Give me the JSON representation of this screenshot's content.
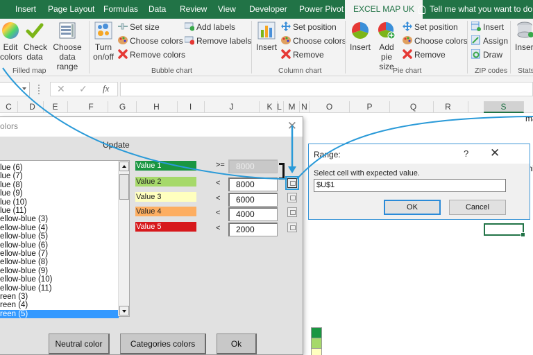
{
  "ribbon": {
    "tabs": [
      {
        "label": "Insert",
        "active": false
      },
      {
        "label": "Page Layout",
        "active": false
      },
      {
        "label": "Formulas",
        "active": false
      },
      {
        "label": "Data",
        "active": false
      },
      {
        "label": "Review",
        "active": false
      },
      {
        "label": "View",
        "active": false
      },
      {
        "label": "Developer",
        "active": false
      },
      {
        "label": "Power Pivot",
        "active": false
      },
      {
        "label": "EXCEL MAP UK",
        "active": true
      }
    ],
    "tell_me": "Tell me what you want to do",
    "groups": {
      "filled_map": {
        "label": "Filled map",
        "edit_colors": [
          "Edit",
          "colors"
        ],
        "check_data": [
          "Check",
          "data"
        ],
        "choose_data_range": [
          "Choose",
          "data range"
        ]
      },
      "bubble_chart": {
        "label": "Bubble chart",
        "turn_onoff": [
          "Turn",
          "on/off"
        ],
        "set_size": "Set size",
        "choose_colors": "Choose colors",
        "remove_colors": "Remove colors",
        "add_labels": "Add labels",
        "remove_labels": "Remove labels"
      },
      "column_chart": {
        "label": "Column chart",
        "insert": "Insert",
        "set_position": "Set position",
        "choose_colors": "Choose colors",
        "remove": "Remove"
      },
      "pie_chart": {
        "label": "Pie chart",
        "insert": "Insert",
        "add_pie_size": [
          "Add",
          "pie size"
        ],
        "set_position": "Set position",
        "choose_colors": "Choose colors",
        "remove": "Remove"
      },
      "zip_codes": {
        "label": "ZIP codes",
        "insert": "Insert",
        "assign": "Assign",
        "draw": "Draw"
      },
      "stats": {
        "label": "Stats",
        "insert": "Insert"
      }
    }
  },
  "formula_bar": {
    "cancel_glyph": "✕",
    "enter_glyph": "✓",
    "fx_label": "fx",
    "value": ""
  },
  "columns": [
    "C",
    "D",
    "E",
    "F",
    "G",
    "H",
    "I",
    "J",
    "K",
    "L",
    "M",
    "N",
    "O",
    "P",
    "Q",
    "R",
    "S"
  ],
  "selected_column": "S",
  "sheet_text": {
    "cell_ma": "ma",
    "cell_mi": "mi"
  },
  "legend_colors": [
    "#1a9641",
    "#a6d96a",
    "#ffffbf"
  ],
  "colors_dialog": {
    "title": "olors",
    "close_glyph": "✕",
    "update_label": "Update",
    "list_items": [
      "lue (6)",
      "lue (7)",
      "lue (8)",
      "lue (9)",
      "lue (10)",
      "lue (11)",
      "ellow-blue (3)",
      "ellow-blue (4)",
      "ellow-blue (5)",
      "ellow-blue (6)",
      "ellow-blue (7)",
      "ellow-blue (8)",
      "ellow-blue (9)",
      "ellow-blue (10)",
      "ellow-blue (11)",
      "reen (3)",
      "reen (4)",
      "reen (5)"
    ],
    "selected_index": 17,
    "values": [
      {
        "label": "Value 1",
        "color": "#1a9641",
        "text_color": "#ffffff",
        "op": ">=",
        "value": "8000",
        "disabled": true
      },
      {
        "label": "Value 2",
        "color": "#a6d96a",
        "text_color": "#222222",
        "op": "<",
        "value": "8000",
        "disabled": false
      },
      {
        "label": "Value 3",
        "color": "#ffffbf",
        "text_color": "#222222",
        "op": "<",
        "value": "6000",
        "disabled": false
      },
      {
        "label": "Value 4",
        "color": "#fdae61",
        "text_color": "#222222",
        "op": "<",
        "value": "4000",
        "disabled": false
      },
      {
        "label": "Value 5",
        "color": "#d7191c",
        "text_color": "#ffffff",
        "op": "<",
        "value": "2000",
        "disabled": false
      }
    ],
    "buttons": {
      "neutral": "Neutral color",
      "categories": "Categories colors",
      "ok": "Ok"
    }
  },
  "range_dialog": {
    "title": "Range:",
    "help_glyph": "?",
    "close_glyph": "✕",
    "prompt": "Select cell with expected value.",
    "value": "$U$1",
    "ok_label": "OK",
    "cancel_label": "Cancel"
  },
  "accent_colors": {
    "excel_green": "#217346",
    "annotation_blue": "#2a9ad8"
  }
}
